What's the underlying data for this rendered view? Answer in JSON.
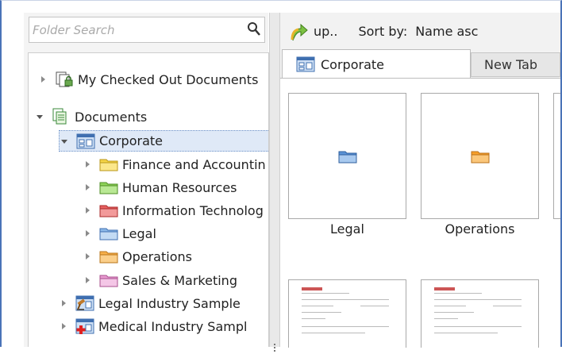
{
  "search": {
    "placeholder": "Folder Search"
  },
  "tree": {
    "items": [
      {
        "label": "My Checked Out Documents",
        "icon": "checked-out-documents-icon"
      },
      {
        "label": "Documents",
        "icon": "documents-icon"
      },
      {
        "label": "Corporate",
        "icon": "corporate-cabinet-icon"
      },
      {
        "label": "Finance and Accountin",
        "icon": "folder-yellow-icon",
        "color": "#f5d547"
      },
      {
        "label": "Human Resources",
        "icon": "folder-green-icon",
        "color": "#8fd45a"
      },
      {
        "label": "Information Technolog",
        "icon": "folder-red-icon",
        "color": "#e86060"
      },
      {
        "label": "Legal",
        "icon": "folder-blue-icon",
        "color": "#8cb8e8"
      },
      {
        "label": "Operations",
        "icon": "folder-orange-icon",
        "color": "#f8b04a"
      },
      {
        "label": "Sales & Marketing",
        "icon": "folder-pink-icon",
        "color": "#e89ad0"
      },
      {
        "label": "Legal Industry Sample",
        "icon": "legal-industry-icon"
      },
      {
        "label": "Medical Industry Sampl",
        "icon": "medical-industry-icon"
      }
    ]
  },
  "toolbar": {
    "up_label": "up..",
    "sort_label": "Sort by:",
    "sort_value": "Name asc"
  },
  "tabs": [
    {
      "label": "Corporate"
    },
    {
      "label": "New Tab"
    }
  ],
  "thumbnails": [
    {
      "label": "Legal"
    },
    {
      "label": "Operations"
    }
  ],
  "colors": {
    "accent": "#4a73b8",
    "selection": "#dfe9f7"
  }
}
